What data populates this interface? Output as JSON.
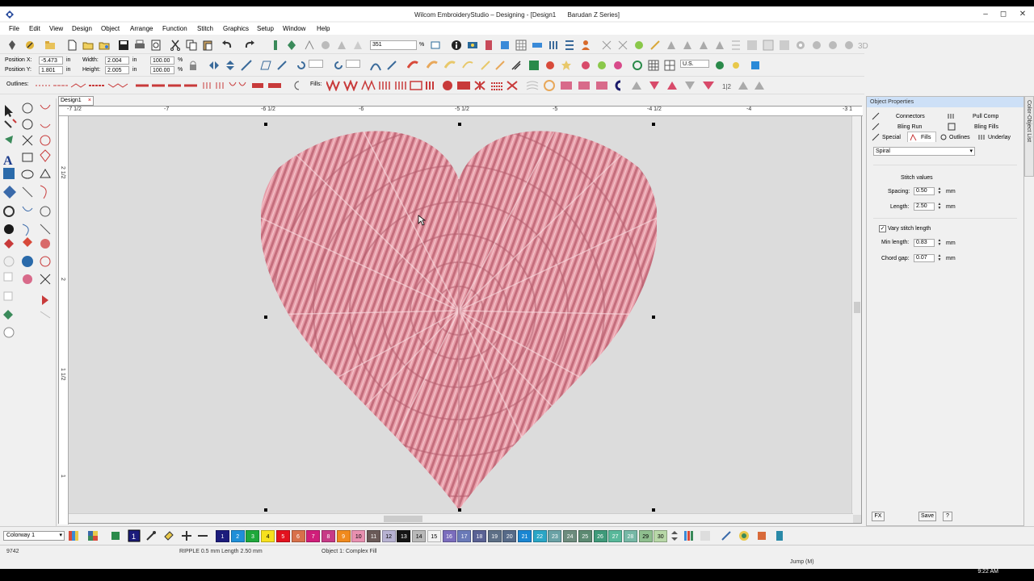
{
  "window": {
    "title": "Wilcom EmbroideryStudio – Designing - [Design1",
    "machine": "Barudan Z Series]",
    "controls": [
      "–",
      "◻",
      "✕"
    ]
  },
  "menu": [
    "File",
    "Edit",
    "View",
    "Design",
    "Object",
    "Arrange",
    "Function",
    "Stitch",
    "Graphics",
    "Setup",
    "Window",
    "Help"
  ],
  "toolbar1": {
    "zoom_value": "351",
    "zoom_unit": "%"
  },
  "position": {
    "x_label": "Position X:",
    "x_value": "-5.473",
    "y_label": "Position Y:",
    "y_value": "1.801",
    "unit": "in",
    "width_label": "Width:",
    "width_value": "2.004",
    "height_label": "Height:",
    "height_value": "2.005",
    "pct_w": "100.00",
    "pct_h": "100.00",
    "pct_unit": "%"
  },
  "outlines_label": "Outlines:",
  "fills_label": "Fills:",
  "lang_select": "U.S.",
  "document_tab": "Design1",
  "rulers": {
    "h_ticks": [
      "-7 1/2",
      "-7",
      "-6 1/2",
      "-6",
      "-5 1/2",
      "-5",
      "-4 1/2",
      "-4",
      "-3 1"
    ],
    "v_ticks": [
      "2 1/2",
      "2",
      "1 1/2",
      "1"
    ]
  },
  "object_properties": {
    "header": "Object Properties",
    "tabs_row1": [
      "Connectors",
      "Pull Comp"
    ],
    "tabs_row2": [
      "Bling Run",
      "Bling Fills"
    ],
    "tabs_row3": [
      "Special",
      "Fills",
      "Outlines",
      "Underlay"
    ],
    "fill_type": "Spiral",
    "section_title": "Stitch values",
    "spacing_label": "Spacing:",
    "spacing_value": "0.50",
    "length_label": "Length:",
    "length_value": "2.50",
    "unit": "mm",
    "vary_label": "Vary stitch length",
    "min_length_label": "Min length:",
    "min_length_value": "0.83",
    "chord_gap_label": "Chord gap:",
    "chord_gap_value": "0.07",
    "fx_button": "FX",
    "save_button": "Save",
    "help_button": "?",
    "side_tab": "Color-Object List"
  },
  "colorway": {
    "label": "Colorway 1",
    "swatches": [
      {
        "n": "1",
        "c": "#1c1c7c"
      },
      {
        "n": "2",
        "c": "#1f8fd8"
      },
      {
        "n": "3",
        "c": "#1fa83b"
      },
      {
        "n": "4",
        "c": "#f7e11e"
      },
      {
        "n": "5",
        "c": "#e3121e"
      },
      {
        "n": "6",
        "c": "#d8704a"
      },
      {
        "n": "7",
        "c": "#d01e7a"
      },
      {
        "n": "8",
        "c": "#c73a86"
      },
      {
        "n": "9",
        "c": "#f08a1e"
      },
      {
        "n": "10",
        "c": "#e890b0"
      },
      {
        "n": "11",
        "c": "#6a5a58"
      },
      {
        "n": "12",
        "c": "#b7b2d2"
      },
      {
        "n": "13",
        "c": "#151515"
      },
      {
        "n": "14",
        "c": "#b9b9b9"
      },
      {
        "n": "15",
        "c": "#f3f3f3"
      },
      {
        "n": "16",
        "c": "#7b6dbd"
      },
      {
        "n": "17",
        "c": "#6a7ab8"
      },
      {
        "n": "18",
        "c": "#5a6294"
      },
      {
        "n": "19",
        "c": "#5d6f86"
      },
      {
        "n": "20",
        "c": "#566a88"
      },
      {
        "n": "21",
        "c": "#1a86d2"
      },
      {
        "n": "22",
        "c": "#2aa6c6"
      },
      {
        "n": "23",
        "c": "#6aa2a6"
      },
      {
        "n": "24",
        "c": "#6d8c7e"
      },
      {
        "n": "25",
        "c": "#5c8a72"
      },
      {
        "n": "26",
        "c": "#3f9a7a"
      },
      {
        "n": "27",
        "c": "#58b89a"
      },
      {
        "n": "28",
        "c": "#76b8a6"
      },
      {
        "n": "29",
        "c": "#8fbf8f"
      },
      {
        "n": "30",
        "c": "#b8d8a8"
      }
    ]
  },
  "status": {
    "stitches": "9742",
    "stitch_info": "RIPPLE  0.5 mm Length  2.50 mm",
    "object_info": "Object 1: Complex Fill",
    "mode": "Jump (M)"
  },
  "taskbar": {
    "clock": "9:22 AM"
  },
  "colors": {
    "accent": "#cde0f7",
    "canvas": "#dcdcdc",
    "heart": "#e59aa5"
  }
}
